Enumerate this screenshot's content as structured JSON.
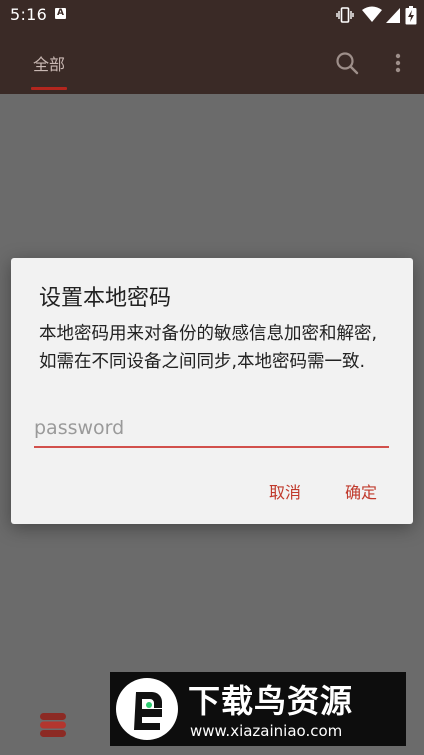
{
  "status_bar": {
    "time": "5:16",
    "notification_icon": "A"
  },
  "app_bar": {
    "tab_all_label": "全部",
    "colors": {
      "bar": "#3a2a26",
      "indicator": "#b3261e"
    }
  },
  "dialog": {
    "title": "设置本地密码",
    "message": "本地密码用来对备份的敏感信息加密和解密,如需在不同设备之间同步,本地密码需一致.",
    "password_placeholder": "password",
    "password_value": "",
    "cancel_label": "取消",
    "ok_label": "确定",
    "accent_color": "#c0392b"
  },
  "watermark": {
    "title": "下载鸟资源",
    "url": "www.xiazainiao.com"
  }
}
